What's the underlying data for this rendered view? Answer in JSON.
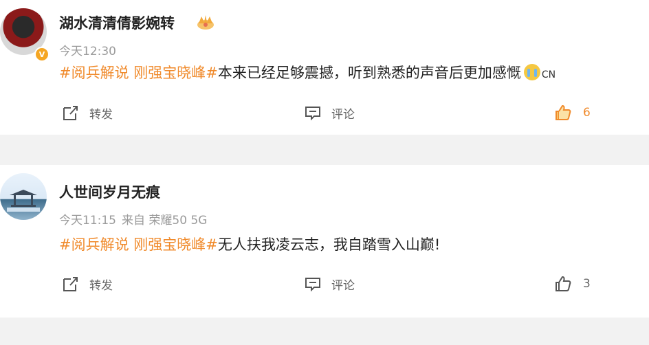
{
  "posts": [
    {
      "username": "湖水清清倩影婉转",
      "meta": {
        "time": "今天12:30",
        "source": ""
      },
      "content": {
        "tags": "#阅兵解说 刚强宝晓峰#",
        "text": "本来已经足够震撼，听到熟悉的声音后更加感慨",
        "suffix": "CN"
      },
      "actions": {
        "repost_label": "转发",
        "comment_label": "评论",
        "like_count": "6"
      },
      "badges": [
        "crown-icon",
        "verified-icon"
      ],
      "like_active_color": "#f08a2b"
    },
    {
      "username": "人世间岁月无痕",
      "meta": {
        "time": "今天11:15",
        "source": "来自 荣耀50 5G"
      },
      "content": {
        "tags": "#阅兵解说 刚强宝晓峰#",
        "text": "无人扶我凌云志，我自踏雪入山巅!",
        "suffix": ""
      },
      "actions": {
        "repost_label": "转发",
        "comment_label": "评论",
        "like_count": "3"
      }
    }
  ],
  "colors": {
    "tag": "#f08a2b",
    "meta": "#9a9a9a",
    "divider": "#f2f2f2"
  }
}
